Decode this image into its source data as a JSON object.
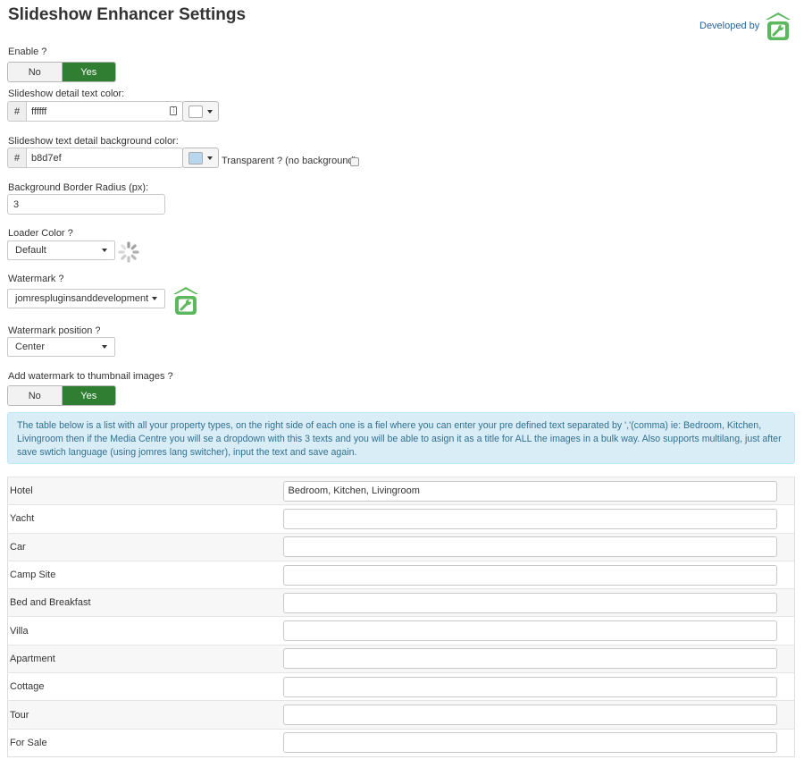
{
  "page": {
    "title": "Slideshow Enhancer Settings",
    "developed_by": "Developed by"
  },
  "colors": {
    "accent": "#2f7e32",
    "logo_green": "#5cb85c",
    "info_bg": "#d9edf7",
    "info_text": "#31708f"
  },
  "enable": {
    "label": "Enable ?",
    "no": "No",
    "yes": "Yes",
    "selected": "Yes"
  },
  "detail_text_color": {
    "label": "Slideshow detail text color:",
    "prefix": "#",
    "value": "ffffff",
    "swatch": "#ffffff"
  },
  "detail_bg_color": {
    "label": "Slideshow text detail background color:",
    "prefix": "#",
    "value": "b8d7ef",
    "swatch": "#b8d7ef",
    "transparent_label": "Transparent ? (no background)",
    "transparent_checked": false
  },
  "border_radius": {
    "label": "Background Border Radius (px):",
    "value": "3"
  },
  "loader_color": {
    "label": "Loader Color ?",
    "selected": "Default"
  },
  "watermark": {
    "label": "Watermark ?",
    "selected": "jomrespluginsanddevelopment.p"
  },
  "watermark_position": {
    "label": "Watermark position ?",
    "selected": "Center"
  },
  "thumb_watermark": {
    "label": "Add watermark to thumbnail images ?",
    "no": "No",
    "yes": "Yes",
    "selected": "Yes"
  },
  "info_text": "The table below is a list with all your property types, on the right side of each one is a fiel where you can enter your pre defined text separated by ','(comma) ie: Bedroom, Kitchen, Livingroom then if the Media Centre you will se a dropdown with this 3 texts and you will be able to asign it as a title for ALL the images in a bulk way. Also supports multilang, just after save swtich language (using jomres lang switcher), input the text and save again.",
  "property_types": [
    {
      "name": "Hotel",
      "value": "Bedroom, Kitchen, Livingroom"
    },
    {
      "name": "Yacht",
      "value": ""
    },
    {
      "name": "Car",
      "value": ""
    },
    {
      "name": "Camp Site",
      "value": ""
    },
    {
      "name": "Bed and Breakfast",
      "value": ""
    },
    {
      "name": "Villa",
      "value": ""
    },
    {
      "name": "Apartment",
      "value": ""
    },
    {
      "name": "Cottage",
      "value": ""
    },
    {
      "name": "Tour",
      "value": ""
    },
    {
      "name": "For Sale",
      "value": ""
    }
  ]
}
